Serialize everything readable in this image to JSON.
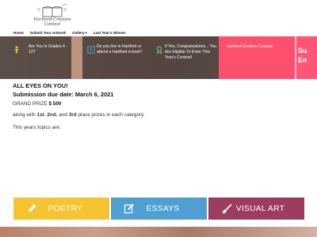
{
  "logo": {
    "text": "Hartford Creative Contest"
  },
  "nav": {
    "items": [
      {
        "label": "Home"
      },
      {
        "label": "Submit Your Artwork"
      },
      {
        "label": "Gallery",
        "has_dropdown": true,
        "caret": "▾"
      },
      {
        "label": "Last Year's Winner"
      }
    ]
  },
  "hero": {
    "step1": {
      "text": "Are You In Grades 4 - 12?",
      "icon": "person-icon"
    },
    "step2": {
      "text": "Do you live in Hartford or attend a Hartford school?",
      "icon": "map-icon"
    },
    "step3": {
      "text": "If Yes, Congratulations... You Are Eligible To Enter This Year's Contest!",
      "icon": "award-icon"
    },
    "pink_text": "Hartford Creative Contest",
    "big_text_1": "Su",
    "big_text_2": "En"
  },
  "content": {
    "headline": "ALL EYES ON YOU!",
    "due_date": "Submission due date: March 6, 2021",
    "grand_prize_label": "GRAND PRIZE",
    "grand_prize_value": "$ 500",
    "places": {
      "prefix": "along with",
      "first": "1st",
      "sep1": ",",
      "second": "2nd",
      "sep2": ", and",
      "third": "3rd",
      "suffix": "place prizes in each category."
    },
    "topics_label": "This years topics are:"
  },
  "categories": [
    {
      "label": "POETRY",
      "icon": "pencil-icon",
      "color": "#f6c431"
    },
    {
      "label": "ESSAYS",
      "icon": "edit-icon",
      "color": "#4f9fd3"
    },
    {
      "label": "VISUAL ART",
      "icon": "brush-icon",
      "color": "#9c3c5f"
    }
  ],
  "colors": {
    "accent_pink": "#ff4f6e",
    "poetry": "#f6c431",
    "essays": "#4f9fd3",
    "visual_art": "#9c3c5f"
  }
}
